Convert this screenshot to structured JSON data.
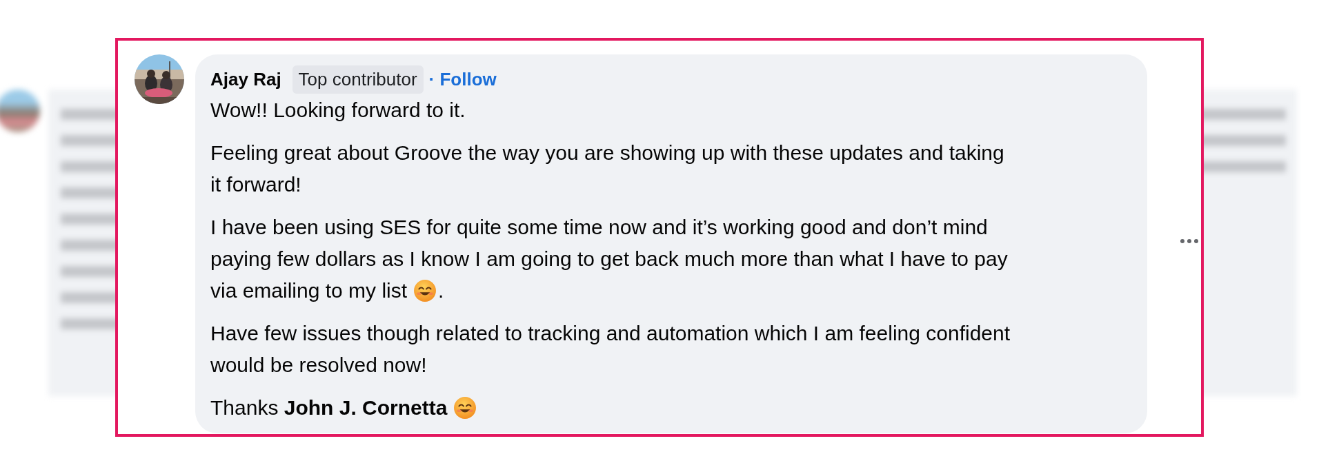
{
  "comment": {
    "author": "Ajay Raj",
    "badge": "Top contributor",
    "follow": "· Follow",
    "avatar": {
      "kind": "picture"
    },
    "paragraphs": [
      [
        [
          {
            "kind": "text",
            "text": "Wow!! Looking forward to it."
          }
        ]
      ],
      [
        [
          {
            "kind": "text",
            "text": "Feeling great about Groove the way you are showing up with these updates and taking"
          }
        ],
        [
          {
            "kind": "text",
            "text": "it forward!"
          }
        ]
      ],
      [
        [
          {
            "kind": "text",
            "text": "I have been using SES for quite some time now and it’s working good and don’t mind"
          }
        ],
        [
          {
            "kind": "text",
            "text": "paying few dollars as I know I am going to get back much more than what I have to pay"
          }
        ],
        [
          {
            "kind": "text",
            "text": "via emailing to my list"
          },
          {
            "kind": "emoji"
          },
          {
            "kind": "text",
            "text": "."
          }
        ]
      ],
      [
        [
          {
            "kind": "text",
            "text": "Have few issues though related to tracking and automation which I am feeling confident"
          }
        ],
        [
          {
            "kind": "text",
            "text": "would be resolved now!"
          }
        ]
      ],
      [
        [
          {
            "kind": "text",
            "text": "Thanks **John J. Cornetta**"
          },
          {
            "kind": "emoji"
          }
        ]
      ]
    ]
  }
}
